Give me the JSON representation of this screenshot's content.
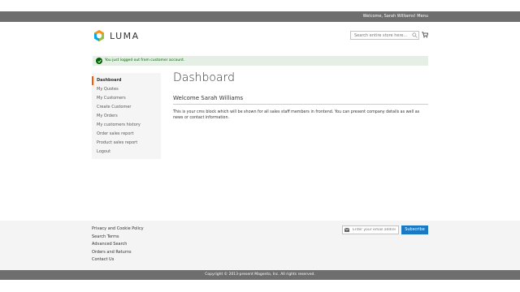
{
  "topbar": {
    "welcome": "Welcome, Sarah Williams! Menu"
  },
  "header": {
    "logo_text": "LUMA",
    "search_placeholder": "Search entire store here..."
  },
  "message": {
    "text": "You just logged out from customer account."
  },
  "sidebar": {
    "items": [
      {
        "label": "Dashboard",
        "active": true
      },
      {
        "label": "My Quotes"
      },
      {
        "label": "My Customers"
      },
      {
        "label": "Create Customer"
      },
      {
        "label": "My Orders"
      },
      {
        "label": "My customers history"
      },
      {
        "label": "Order sales report"
      },
      {
        "label": "Product sales report"
      },
      {
        "label": "Logout"
      }
    ]
  },
  "main": {
    "title": "Dashboard",
    "welcome": "Welcome Sarah Williams",
    "body": "This is your cms block which will be shown for all sales staff members in frontend. You can present company details as well as news or contact information."
  },
  "footer": {
    "links": [
      "Privacy and Cookie Policy",
      "Search Terms",
      "Advanced Search",
      "Orders and Returns",
      "Contact Us"
    ],
    "newsletter_placeholder": "Enter your email address",
    "subscribe_label": "Subscribe",
    "copyright": "Copyright © 2013-present Magento, Inc. All rights reserved."
  },
  "colors": {
    "accent": "#ff5501",
    "primary_button": "#1979c3",
    "success_bg": "#e5efe5",
    "success_text": "#006400",
    "bar": "#6e6e6e"
  },
  "icons": [
    "luma-logo-icon",
    "search-icon",
    "cart-icon",
    "check-icon",
    "mail-icon"
  ]
}
